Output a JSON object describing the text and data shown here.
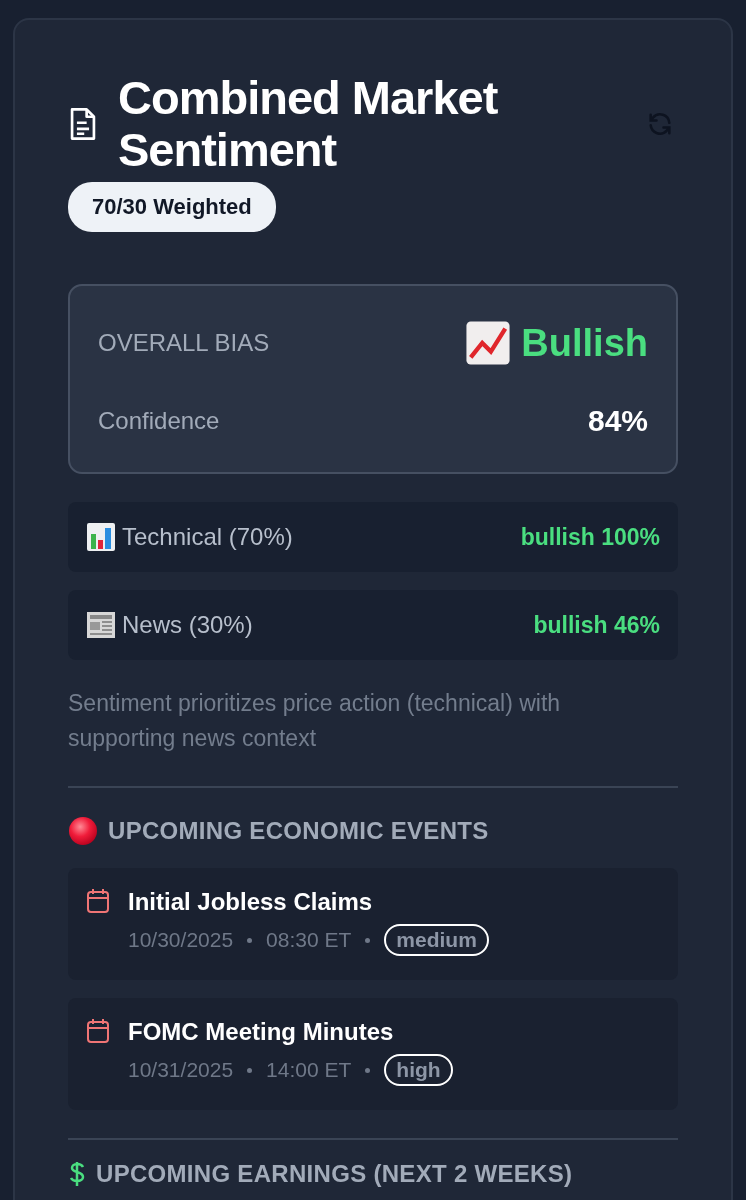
{
  "header": {
    "title": "Combined Market Sentiment",
    "badge": "70/30 Weighted"
  },
  "overall": {
    "label": "OVERALL BIAS",
    "bias": "Bullish",
    "confidence_label": "Confidence",
    "confidence": "84%"
  },
  "components": [
    {
      "kind": "chart",
      "label": "Technical (70%)",
      "reading": "bullish 100%"
    },
    {
      "kind": "newspaper",
      "label": "News (30%)",
      "reading": "bullish 46%"
    }
  ],
  "note": "Sentiment prioritizes price action (technical) with supporting news context",
  "events_heading": "UPCOMING ECONOMIC EVENTS",
  "events": [
    {
      "title": "Initial Jobless Claims",
      "date": "10/30/2025",
      "time": "08:30 ET",
      "impact": "medium"
    },
    {
      "title": "FOMC Meeting Minutes",
      "date": "10/31/2025",
      "time": "14:00 ET",
      "impact": "high"
    }
  ],
  "earnings_heading": "UPCOMING EARNINGS (NEXT 2 WEEKS)"
}
